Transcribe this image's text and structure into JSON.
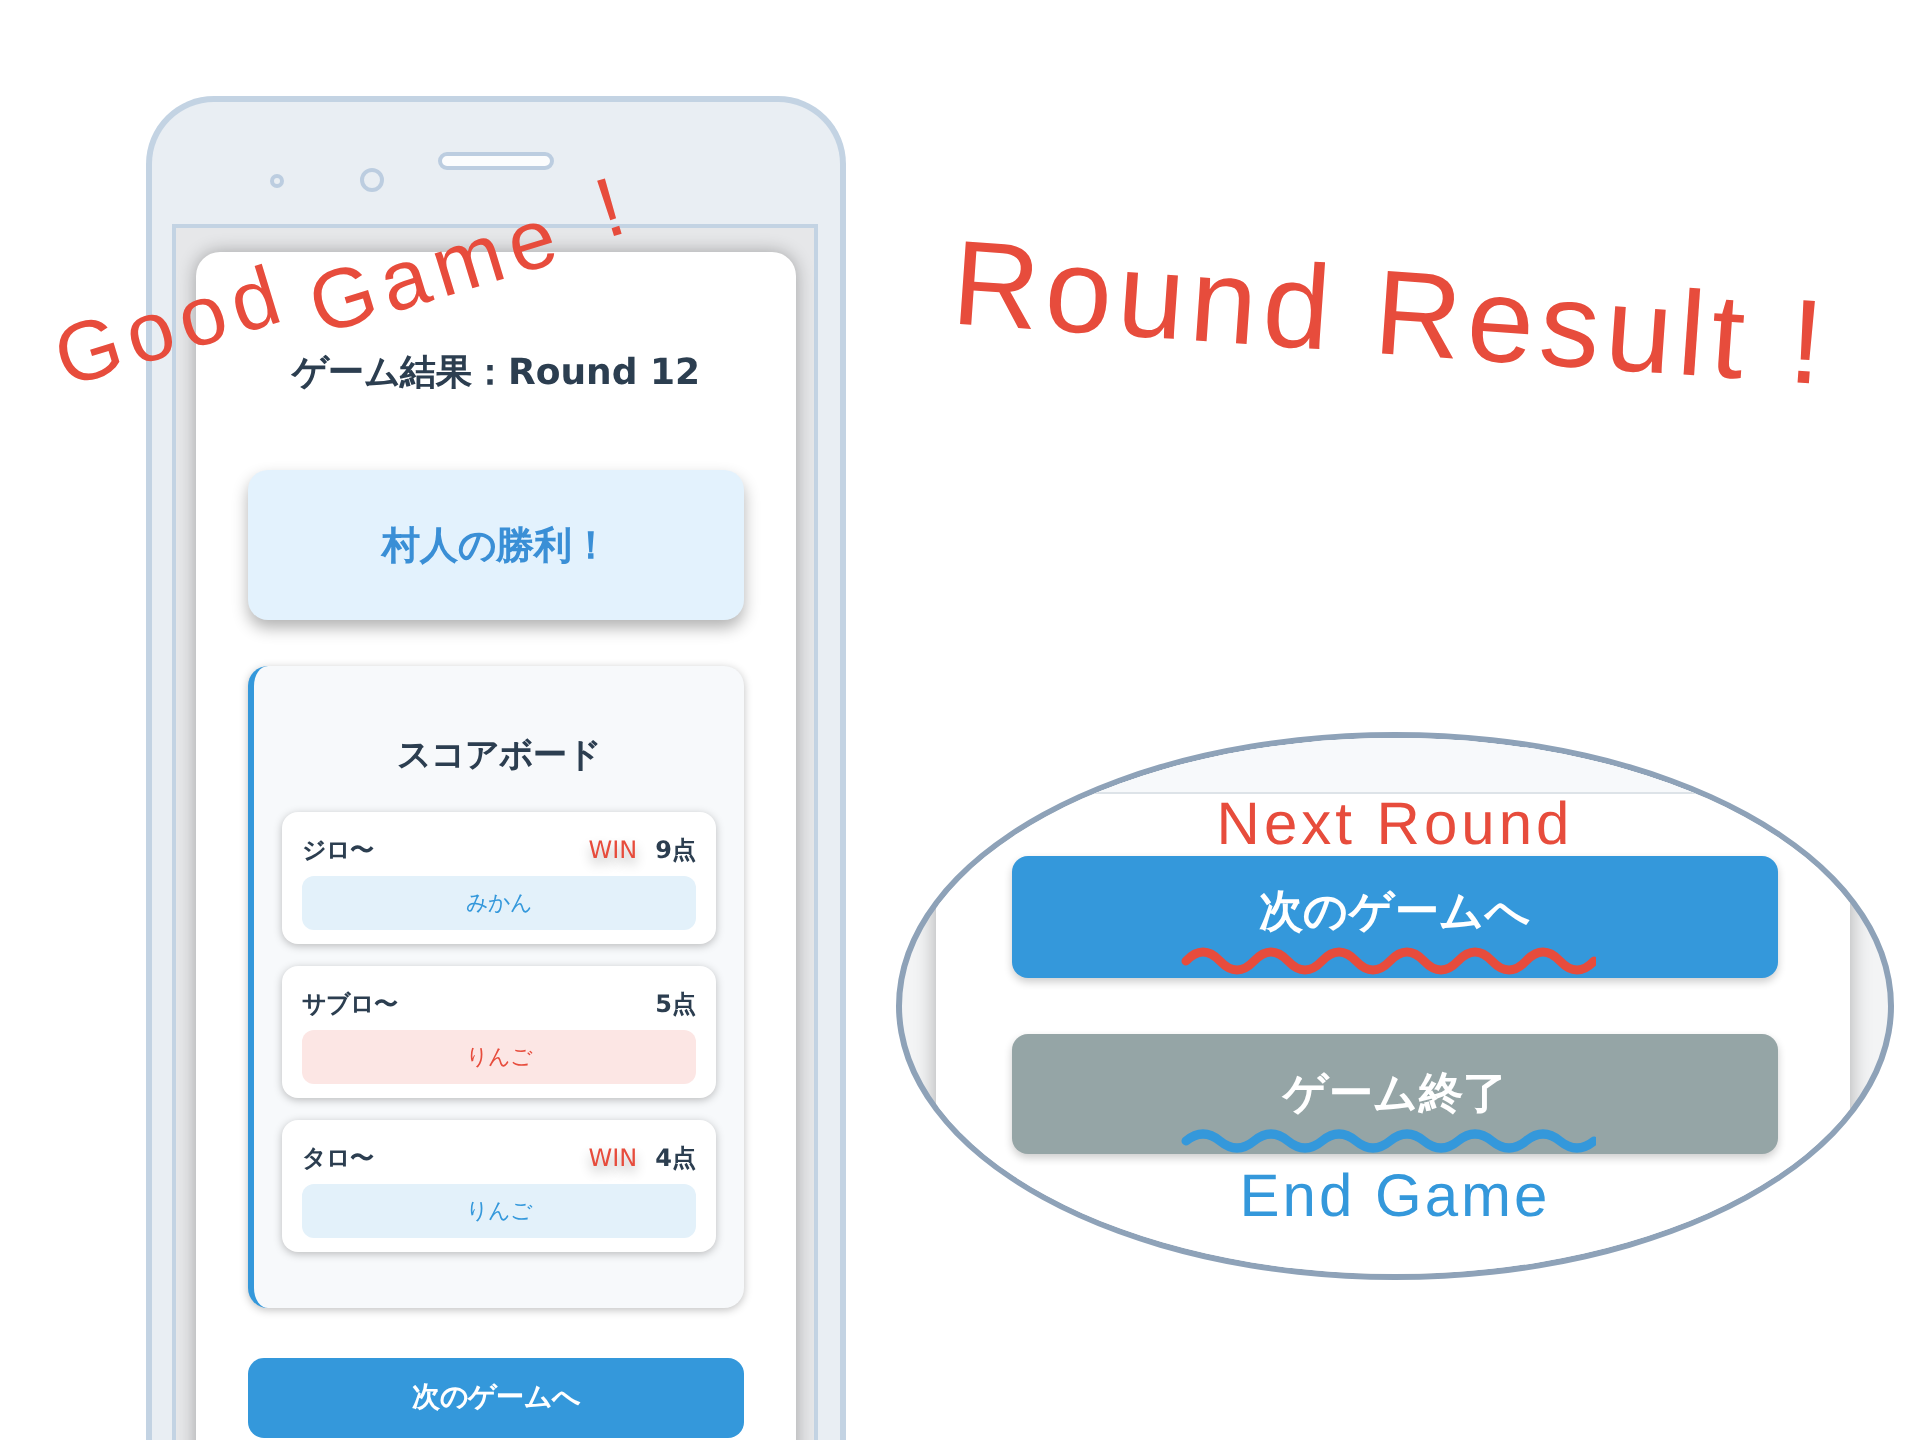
{
  "annotations": {
    "good_game": [
      "Good",
      "Game",
      "!"
    ],
    "round_result": "Round Result !"
  },
  "phone": {
    "title": "ゲーム結果：Round 12",
    "winner_banner": "村人の勝利！",
    "scoreboard": {
      "title": "スコアボード",
      "players": [
        {
          "name": "ジロ〜",
          "badge": "WIN",
          "points": "9点",
          "role": "みかん",
          "color": "#3498db"
        },
        {
          "name": "サブロ〜",
          "points": "5点",
          "role": "りんご",
          "color": "#e74c3c"
        },
        {
          "name": "タロ〜",
          "badge": "WIN",
          "points": "4点",
          "role": "りんご",
          "color": "#3498db"
        }
      ]
    },
    "next_button": "次のゲームへ"
  },
  "callout": {
    "next_label": "Next Round",
    "next_button": "次のゲームへ",
    "end_button": "ゲーム終了",
    "end_label": "End Game"
  }
}
